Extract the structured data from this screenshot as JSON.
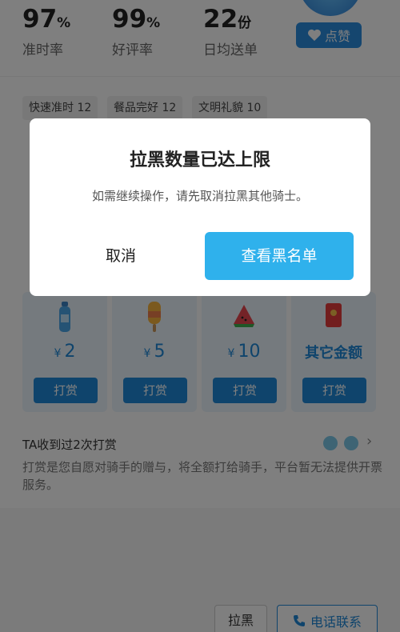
{
  "stats": [
    {
      "value": "97",
      "unit": "%",
      "label": "准时率"
    },
    {
      "value": "99",
      "unit": "%",
      "label": "好评率"
    },
    {
      "value": "22",
      "unit": "份",
      "label": "日均送单"
    }
  ],
  "like_label": "点赞",
  "tags": [
    "快速准时 12",
    "餐品完好 12",
    "文明礼貌 10"
  ],
  "tip": {
    "options": [
      {
        "currency": "¥",
        "amount": "2",
        "button": "打赏",
        "icon": "water-bottle-icon"
      },
      {
        "currency": "¥",
        "amount": "5",
        "button": "打赏",
        "icon": "popsicle-icon"
      },
      {
        "currency": "¥",
        "amount": "10",
        "button": "打赏",
        "icon": "watermelon-icon"
      },
      {
        "currency": "",
        "amount": "其它金额",
        "button": "打赏",
        "icon": "red-envelope-icon"
      }
    ],
    "count_text": "TA收到过2次打赏",
    "description": "打赏是您自愿对骑手的赠与，将全额打给骑手，平台暂无法提供开票服务。"
  },
  "bottom": {
    "block_label": "拉黑",
    "call_label": "电话联系"
  },
  "dialog": {
    "title": "拉黑数量已达上限",
    "message": "如需继续操作，请先取消拉黑其他骑士。",
    "cancel_label": "取消",
    "confirm_label": "查看黑名单"
  },
  "colors": {
    "accent": "#1e88d8",
    "dialog_confirm": "#2fb1ec",
    "overlay": "rgba(0,0,0,0.5)"
  }
}
